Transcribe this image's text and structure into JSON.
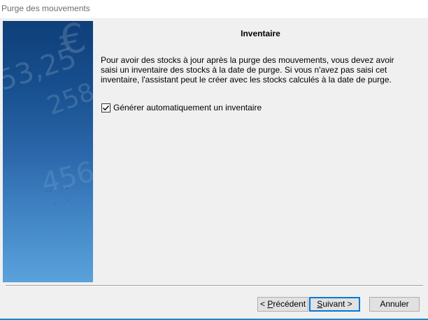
{
  "window": {
    "title": "Purge des mouvements"
  },
  "banner": {
    "decor_texts": [
      "53,25",
      "€",
      "258,",
      "456,"
    ]
  },
  "page": {
    "heading": "Inventaire",
    "description": "Pour avoir des stocks à jour après la purge des mouvements, vous devez avoir saisi un inventaire des stocks à la date de purge. Si vous n'avez pas saisi cet inventaire, l'assistant peut le créer avec les stocks calculés à la date de purge."
  },
  "options": {
    "auto_inventory": {
      "label": "Générer automatiquement un inventaire",
      "checked": true
    }
  },
  "buttons": {
    "previous": {
      "prefix": "< ",
      "accel": "P",
      "rest": "récédent"
    },
    "next": {
      "accel": "S",
      "rest": "uivant >"
    },
    "cancel": {
      "label": "Annuler"
    }
  },
  "colors": {
    "banner_top": "#0e3f79",
    "banner_bottom": "#5aa2dc",
    "default_button_border": "#0078d7",
    "window_bg": "#f0f0f0"
  }
}
